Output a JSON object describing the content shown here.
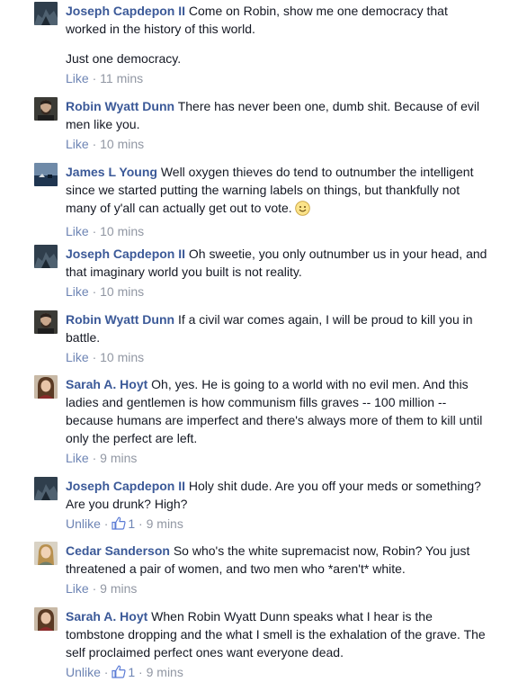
{
  "comments": [
    {
      "author": "Joseph Capdepon II",
      "text": "Come on Robin, show me one democracy that worked in the history of this world.",
      "text2": "Just one democracy.",
      "action": "Like",
      "time": "11 mins",
      "avatar_icon": "avatar-icon"
    },
    {
      "author": "Robin Wyatt Dunn",
      "text": "There has never been one, dumb shit. Because of evil men like you.",
      "action": "Like",
      "time": "10 mins",
      "avatar_icon": "avatar-icon"
    },
    {
      "author": "James L Young",
      "text": "Well oxygen thieves do tend to outnumber the intelligent since we started putting the warning labels on things, but thankfully not many of y'all can actually get out to vote.",
      "emoticon": "smile-emoticon",
      "action": "Like",
      "time": "10 mins",
      "avatar_icon": "avatar-icon"
    },
    {
      "author": "Joseph Capdepon II",
      "text": "Oh sweetie, you only outnumber us in your head, and that imaginary world you built is not reality.",
      "action": "Like",
      "time": "10 mins",
      "avatar_icon": "avatar-icon"
    },
    {
      "author": "Robin Wyatt Dunn",
      "text": "If a civil war comes again, I will be proud to kill you in battle.",
      "action": "Like",
      "time": "10 mins",
      "avatar_icon": "avatar-icon"
    },
    {
      "author": "Sarah A. Hoyt",
      "text": "Oh, yes. He is going to a world with no evil men. And this ladies and gentlemen is how communism fills graves -- 100 million -- because humans are imperfect and there's always more of them to kill until only the perfect are left.",
      "action": "Like",
      "time": "9 mins",
      "avatar_icon": "avatar-icon"
    },
    {
      "author": "Joseph Capdepon II",
      "text": "Holy shit dude. Are you off your meds or something? Are you drunk? High?",
      "action": "Unlike",
      "likes": "1",
      "time": "9 mins",
      "avatar_icon": "avatar-icon"
    },
    {
      "author": "Cedar Sanderson",
      "text": "So who's the white supremacist now, Robin? You just threatened a pair of women, and two men who *aren't* white.",
      "action": "Like",
      "time": "9 mins",
      "avatar_icon": "avatar-icon"
    },
    {
      "author": "Sarah A. Hoyt",
      "text": "When Robin Wyatt Dunn speaks what I hear is the tombstone dropping and the what I smell is the exhalation of the grave. The self proclaimed perfect ones want everyone dead.",
      "action": "Unlike",
      "likes": "1",
      "time": "9 mins",
      "avatar_icon": "avatar-icon"
    }
  ],
  "separator": "·",
  "colors": {
    "author": "#3b5998",
    "link": "#6d84b4",
    "meta": "#9197a3",
    "text": "#141823"
  }
}
